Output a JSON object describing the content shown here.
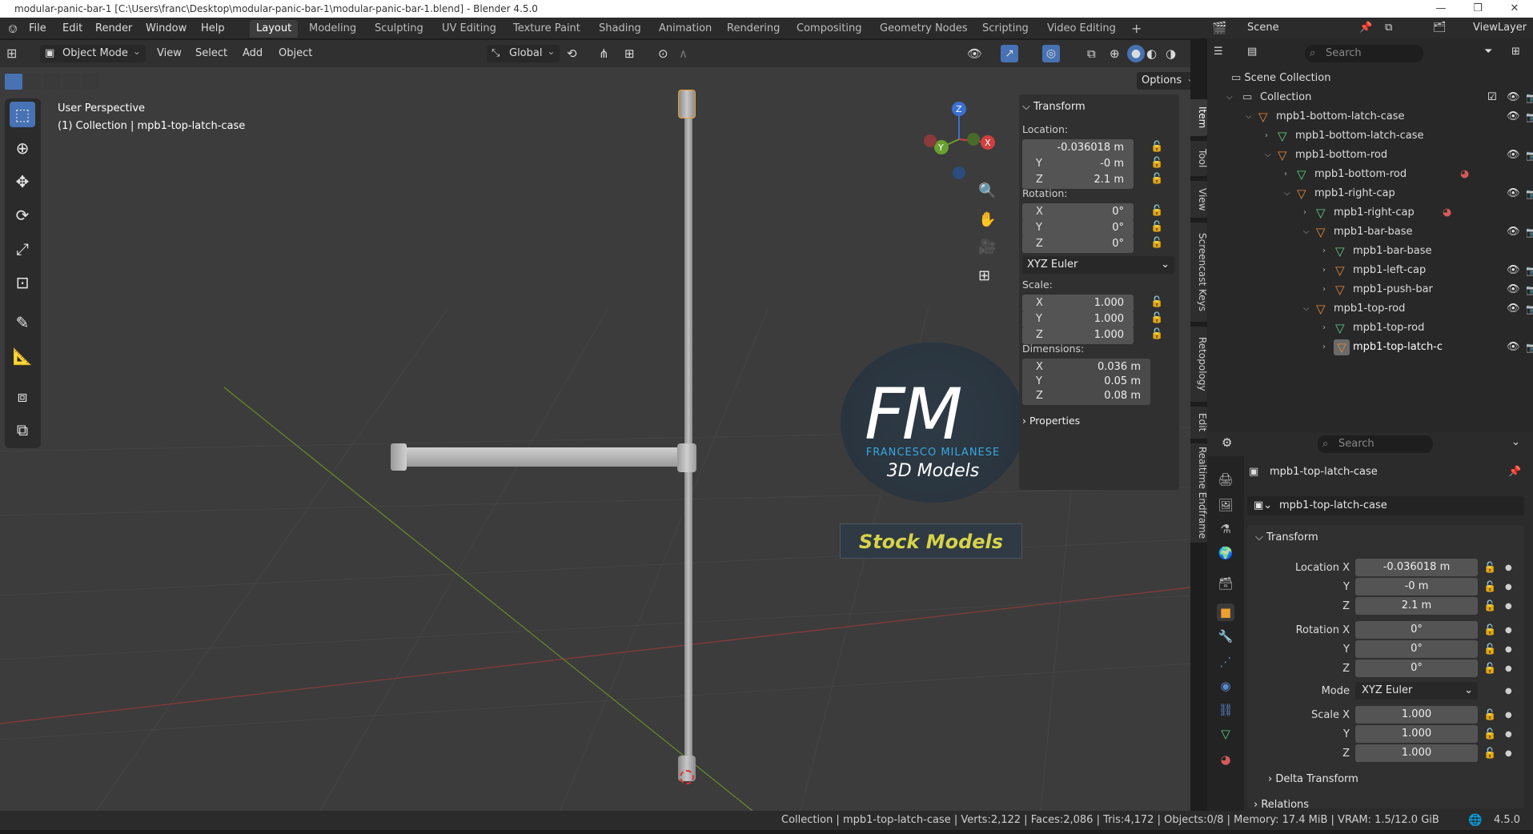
{
  "window": {
    "title": "modular-panic-bar-1 [C:\\Users\\franc\\Desktop\\modular-panic-bar-1\\modular-panic-bar-1.blend] - Blender 4.5.0",
    "minimize": "—",
    "maximize": "❐",
    "close": "✕"
  },
  "menu": [
    "File",
    "Edit",
    "Render",
    "Window",
    "Help"
  ],
  "workspaces": [
    "Layout",
    "Modeling",
    "Sculpting",
    "UV Editing",
    "Texture Paint",
    "Shading",
    "Animation",
    "Rendering",
    "Compositing",
    "Geometry Nodes",
    "Scripting",
    "Video Editing",
    "+"
  ],
  "scene": {
    "scene_name": "Scene",
    "view_layer": "ViewLayer"
  },
  "viewport_header": {
    "mode": "Object Mode",
    "menus": [
      "View",
      "Select",
      "Add",
      "Object"
    ],
    "orientation": "Global",
    "options": "Options"
  },
  "viewport": {
    "perspective": "User Perspective",
    "collection_info": "(1) Collection | mpb1-top-latch-case",
    "gizmo": {
      "z": "Z",
      "y": "Y",
      "x": "X"
    },
    "watermark": {
      "initials": "FM",
      "name": "FRANCESCO MILANESE",
      "sub": "3D Models",
      "stock": "Stock Models"
    }
  },
  "npanel": {
    "title": "Transform",
    "location_label": "Location:",
    "location": [
      {
        "axis": "X",
        "value": "-0.036018 m"
      },
      {
        "axis": "Y",
        "value": "-0 m"
      },
      {
        "axis": "Z",
        "value": "2.1 m"
      }
    ],
    "rotation_label": "Rotation:",
    "rotation": [
      {
        "axis": "X",
        "value": "0°"
      },
      {
        "axis": "Y",
        "value": "0°"
      },
      {
        "axis": "Z",
        "value": "0°"
      }
    ],
    "rotation_mode": "XYZ Euler",
    "scale_label": "Scale:",
    "scale": [
      {
        "axis": "X",
        "value": "1.000"
      },
      {
        "axis": "Y",
        "value": "1.000"
      },
      {
        "axis": "Z",
        "value": "1.000"
      }
    ],
    "dimensions_label": "Dimensions:",
    "dimensions": [
      {
        "axis": "X",
        "value": "0.036 m"
      },
      {
        "axis": "Y",
        "value": "0.05 m"
      },
      {
        "axis": "Z",
        "value": "0.08 m"
      }
    ],
    "properties_label": "Properties"
  },
  "vertical_tabs": [
    "Item",
    "Tool",
    "View",
    "Screencast Keys",
    "Retopology",
    "Edit",
    "Realtime Endframe"
  ],
  "outliner": {
    "search_placeholder": "Search",
    "rows": [
      {
        "label": "Scene Collection",
        "kind": "scene"
      },
      {
        "label": "Collection",
        "kind": "collection"
      },
      {
        "label": "mpb1-bottom-latch-case",
        "kind": "object"
      },
      {
        "label": "mpb1-bottom-latch-case",
        "kind": "mesh"
      },
      {
        "label": "mpb1-bottom-rod",
        "kind": "object"
      },
      {
        "label": "mpb1-bottom-rod",
        "kind": "mesh"
      },
      {
        "label": "mpb1-right-cap",
        "kind": "object"
      },
      {
        "label": "mpb1-right-cap",
        "kind": "mesh"
      },
      {
        "label": "mpb1-bar-base",
        "kind": "object"
      },
      {
        "label": "mpb1-bar-base",
        "kind": "mesh"
      },
      {
        "label": "mpb1-left-cap",
        "kind": "object"
      },
      {
        "label": "mpb1-push-bar",
        "kind": "object"
      },
      {
        "label": "mpb1-top-rod",
        "kind": "object"
      },
      {
        "label": "mpb1-top-rod",
        "kind": "mesh"
      },
      {
        "label": "mpb1-top-latch-c",
        "kind": "object"
      }
    ]
  },
  "properties": {
    "search_placeholder": "Search",
    "object_name": "mpb1-top-latch-case",
    "object_field": "mpb1-top-latch-case",
    "transform_title": "Transform",
    "location_x_label": "Location X",
    "location": [
      "-0.036018 m",
      "-0 m",
      "2.1 m"
    ],
    "rotation_x_label": "Rotation X",
    "rotation": [
      "0°",
      "0°",
      "0°"
    ],
    "mode_label": "Mode",
    "mode": "XYZ Euler",
    "scale_x_label": "Scale X",
    "scale": [
      "1.000",
      "1.000",
      "1.000"
    ],
    "axis_y": "Y",
    "axis_z": "Z",
    "delta_transform": "Delta Transform",
    "relations": "Relations"
  },
  "status": {
    "text": "Collection | mpb1-top-latch-case | Verts:2,122 | Faces:2,086 | Tris:4,172 | Objects:0/8 | Memory: 17.4 MiB | VRAM: 1.5/12.0 GiB",
    "version": "4.5.0"
  }
}
